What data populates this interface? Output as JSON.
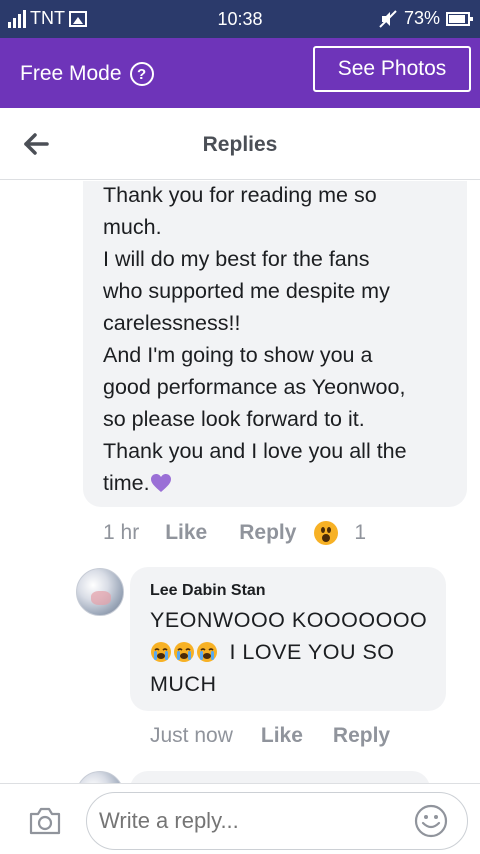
{
  "status_bar": {
    "carrier": "TNT",
    "time": "10:38",
    "battery": "73%",
    "icons": [
      "signal-icon",
      "image-icon",
      "mute-icon",
      "battery-icon"
    ]
  },
  "free_bar": {
    "label": "Free Mode",
    "help_glyph": "?",
    "see_photos": "See Photos",
    "color": "#6e34b9"
  },
  "header": {
    "title": "Replies"
  },
  "main_comment": {
    "lines": [
      "Thank you for reading me so",
      "much.",
      "I will do my best for the fans",
      "who supported me despite my",
      "carelessness!!",
      "And I'm going to show you a",
      "good performance as Yeonwoo,",
      "so please look forward to it.",
      "Thank you and I love you all the",
      "time."
    ],
    "time": "1 hr",
    "like": "Like",
    "reply": "Reply",
    "reaction_count": "1"
  },
  "reply_comment": {
    "author": "Lee Dabin Stan",
    "line1": "YEONWOOO KOOOOOOO",
    "line2": "I LOVE YOU SO",
    "line3": "MUCH",
    "time": "Just now",
    "like": "Like",
    "reply": "Reply"
  },
  "compose": {
    "placeholder": "Write a reply..."
  }
}
